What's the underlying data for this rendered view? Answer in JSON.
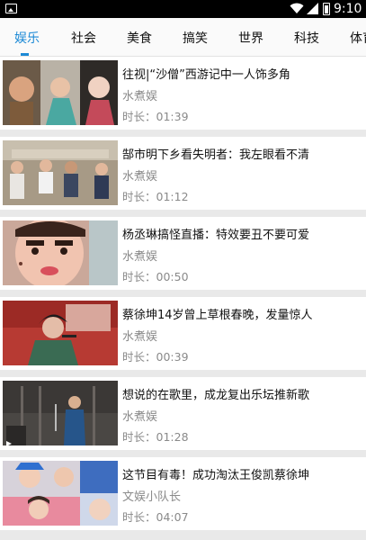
{
  "status_bar": {
    "time": "9:10"
  },
  "tabs": [
    {
      "label": "娱乐",
      "active": true
    },
    {
      "label": "社会"
    },
    {
      "label": "美食"
    },
    {
      "label": "搞笑"
    },
    {
      "label": "世界"
    },
    {
      "label": "科技"
    },
    {
      "label": "体育"
    }
  ],
  "videos": [
    {
      "title": "往视|“沙僧”西游记中一人饰多角",
      "author": "水煮娱",
      "duration_label": "时长：",
      "duration": "01:39"
    },
    {
      "title": "郜市明下乡看失明者：我左眼看不清",
      "author": "水煮娱",
      "duration_label": "时长：",
      "duration": "01:12"
    },
    {
      "title": "杨丞琳搞怪直播：特效要丑不要可爱",
      "author": "水煮娱",
      "duration_label": "时长：",
      "duration": "00:50"
    },
    {
      "title": "蔡徐坤14岁曾上草根春晚，发量惊人",
      "author": "水煮娱",
      "duration_label": "时长：",
      "duration": "00:39"
    },
    {
      "title": "想说的在歌里，成龙复出乐坛推新歌",
      "author": "水煮娱",
      "duration_label": "时长：",
      "duration": "01:28"
    },
    {
      "title": "这节目有毒！成功淘汰王俊凯蔡徐坤",
      "author": "文娱小队长",
      "duration_label": "时长：",
      "duration": "04:07"
    }
  ],
  "colors": {
    "accent": "#1d8ad6",
    "status_bar": "#000000",
    "background": "#e9e9e9"
  }
}
